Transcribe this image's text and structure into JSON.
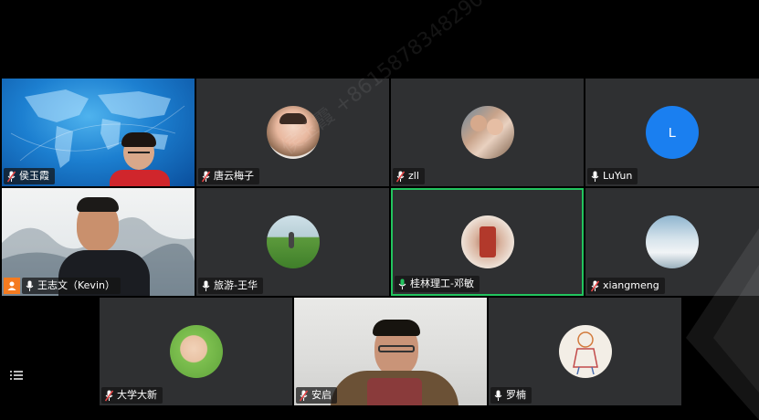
{
  "participants": [
    {
      "name": "侯玉霞",
      "mic": "muted",
      "video": "on"
    },
    {
      "name": "唐云梅子",
      "mic": "muted",
      "video": "off"
    },
    {
      "name": "zll",
      "mic": "muted",
      "video": "off"
    },
    {
      "name": "LuYun",
      "mic": "on",
      "video": "off",
      "initial": "L"
    },
    {
      "name": "王志文（Kevin）",
      "mic": "on",
      "video": "on"
    },
    {
      "name": "旅游-王华",
      "mic": "on",
      "video": "off"
    },
    {
      "name": "桂林理工-邓敏",
      "mic": "speaking",
      "video": "off"
    },
    {
      "name": "xiangmeng",
      "mic": "muted",
      "video": "off"
    },
    {
      "name": "大学大新",
      "mic": "muted",
      "video": "off"
    },
    {
      "name": "安启",
      "mic": "muted",
      "video": "on"
    },
    {
      "name": "罗楠",
      "mic": "on",
      "video": "off"
    }
  ],
  "watermark": "侯玉霞 +8615878348290",
  "colors": {
    "tile_bg": "#2f3032",
    "active_border": "#22c45e",
    "avatar_blue": "#1a7ff0",
    "muted_red": "#e64545"
  }
}
